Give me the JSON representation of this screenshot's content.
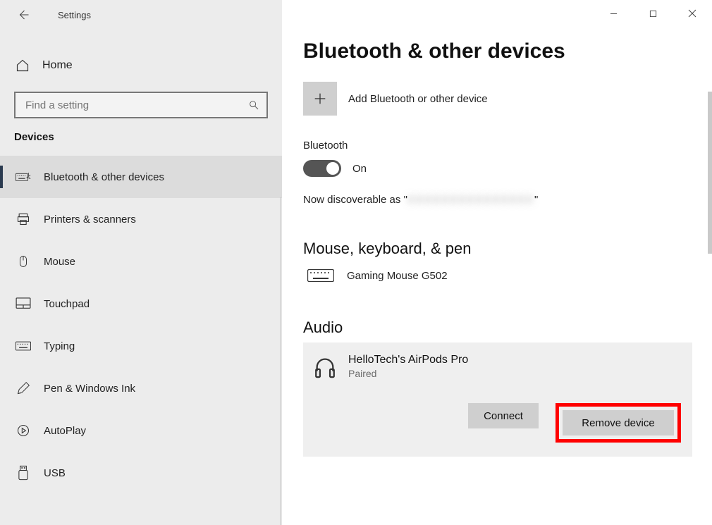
{
  "window": {
    "title": "Settings"
  },
  "sidebar": {
    "home": "Home",
    "search_placeholder": "Find a setting",
    "section": "Devices",
    "items": [
      {
        "label": "Bluetooth & other devices"
      },
      {
        "label": "Printers & scanners"
      },
      {
        "label": "Mouse"
      },
      {
        "label": "Touchpad"
      },
      {
        "label": "Typing"
      },
      {
        "label": "Pen & Windows Ink"
      },
      {
        "label": "AutoPlay"
      },
      {
        "label": "USB"
      }
    ]
  },
  "main": {
    "title": "Bluetooth & other devices",
    "add_label": "Add Bluetooth or other device",
    "bt_label": "Bluetooth",
    "toggle_state": "On",
    "discoverable_prefix": "Now discoverable as \"",
    "discoverable_name": "XXXXXXXXXXXXXXX",
    "discoverable_suffix": "\"",
    "section_mouse": "Mouse, keyboard, & pen",
    "mouse_device": "Gaming Mouse G502",
    "section_audio": "Audio",
    "audio_device_name": "HelloTech's AirPods Pro",
    "audio_device_status": "Paired",
    "connect_label": "Connect",
    "remove_label": "Remove device"
  }
}
